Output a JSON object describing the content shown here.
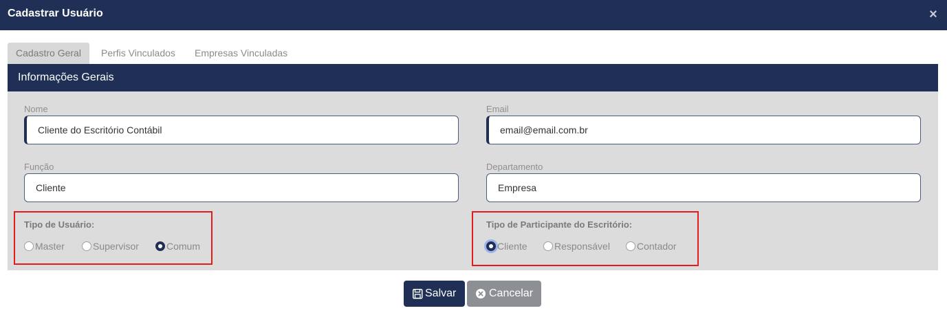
{
  "dialog": {
    "title": "Cadastrar Usuário",
    "close_glyph": "×"
  },
  "tabs": [
    {
      "label": "Cadastro Geral",
      "active": true
    },
    {
      "label": "Perfis Vinculados",
      "active": false
    },
    {
      "label": "Empresas Vinculadas",
      "active": false
    }
  ],
  "section": {
    "title": "Informações Gerais"
  },
  "fields": {
    "nome": {
      "label": "Nome",
      "value": "Cliente do Escritório Contábil"
    },
    "email": {
      "label": "Email",
      "value": "email@email.com.br"
    },
    "funcao": {
      "label": "Função",
      "value": "Cliente"
    },
    "departamento": {
      "label": "Departamento",
      "value": "Empresa"
    }
  },
  "tipo_usuario": {
    "label": "Tipo de Usuário:",
    "options": [
      "Master",
      "Supervisor",
      "Comum"
    ],
    "selected": "Comum"
  },
  "tipo_participante": {
    "label": "Tipo de Participante do Escritório:",
    "options": [
      "Cliente",
      "Responsável",
      "Contador"
    ],
    "selected": "Cliente"
  },
  "buttons": {
    "save_label": "Salvar",
    "cancel_label": "Cancelar"
  },
  "colors": {
    "navy": "#1f2f55",
    "panel": "#dcdcdc",
    "highlight": "#e31b1b",
    "cancel": "#8c8f94"
  }
}
